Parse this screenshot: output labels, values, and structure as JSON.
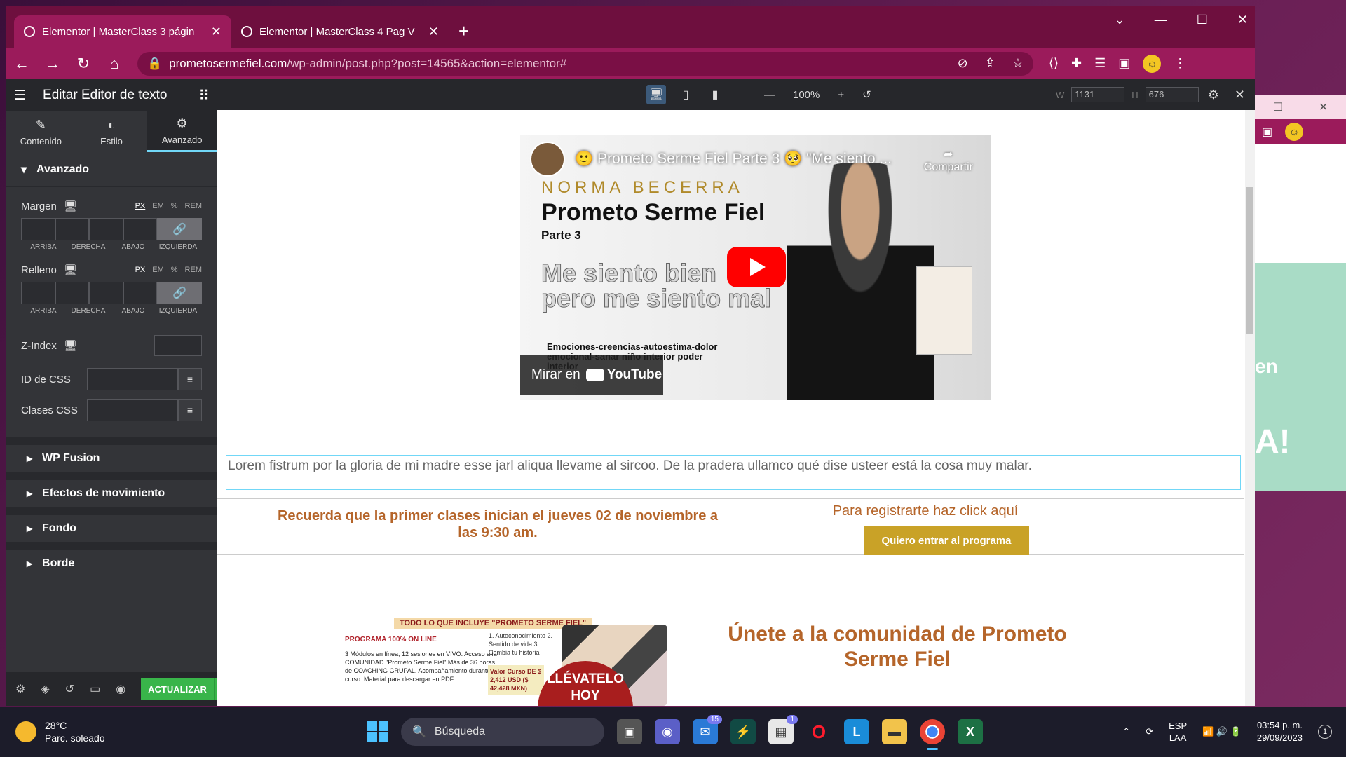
{
  "browser": {
    "tabs": [
      {
        "title": "Elementor | MasterClass 3 págin",
        "close": "✕"
      },
      {
        "title": "Elementor | MasterClass 4 Pag V",
        "close": "✕"
      }
    ],
    "new_tab": "+",
    "window_controls": [
      "⌄",
      "—",
      "☐",
      "✕"
    ],
    "url_domain": "prometosermefiel.com",
    "url_path": "/wp-admin/post.php?post=14565&action=elementor#"
  },
  "panel": {
    "title": "Editar Editor de texto",
    "tabs": [
      {
        "label": "Contenido",
        "icon": "pencil-icon"
      },
      {
        "label": "Estilo",
        "icon": "half-circle-icon"
      },
      {
        "label": "Avanzado",
        "icon": "gear-icon"
      }
    ],
    "section_title": "Avanzado",
    "margen_label": "Margen",
    "relleno_label": "Relleno",
    "units": [
      "PX",
      "EM",
      "%",
      "REM"
    ],
    "dim_labels": [
      "ARRIBA",
      "DERECHA",
      "ABAJO",
      "IZQUIERDA"
    ],
    "zindex_label": "Z-Index",
    "css_id_label": "ID de CSS",
    "css_classes_label": "Clases CSS",
    "collapsed_sections": [
      "WP Fusion",
      "Efectos de movimiento",
      "Fondo",
      "Borde"
    ],
    "update_label": "ACTUALIZAR"
  },
  "preview_bar": {
    "zoom": "100%",
    "w_label": "W",
    "w_value": "1131",
    "h_label": "H",
    "h_value": "676"
  },
  "video": {
    "title": "🙂 Prometo Serme Fiel Parte 3 🥺 \"Me siento ...",
    "share": "Compartir",
    "author": "NORMA BECERRA",
    "big_title": "Prometo Serme Fiel",
    "part": "Parte 3",
    "tagline": "Me siento bien pero me siento mal",
    "sub_tag": "Emociones-creencias-autoestima-dolor emocional-sanar niño interior poder interior",
    "watch_on": "Mirar en",
    "yt_brand": "YouTube"
  },
  "page": {
    "lorem": "Lorem fistrum por la gloria de mi madre esse jarl aliqua llevame al sircoo. De la pradera ullamco qué dise usteer está la cosa muy malar.",
    "cta_left": "Recuerda que la primer clases inician el jueves 02 de noviembre a las 9:30 am.",
    "cta_right_label": "Para registrarte haz click aquí",
    "cta_button": "Quiero entrar al programa",
    "promo_head": "TODO LO QUE INCLUYE \"PROMETO SERME FIEL\"",
    "promo_sub": "PROGRAMA 100% ON LINE",
    "promo_list": "3 Módulos en línea, 12 sesiones en VIVO. Acceso a la COMUNIDAD \"Prometo Serme Fiel\" Más de 36 horas de COACHING GRUPAL. Acompañamiento durante el curso. Material para descargar en PDF",
    "promo_list2": "1. Autoconocimiento 2. Sentido de vida 3. Cambia tu historia",
    "promo_price": "Valor Curso DE $ 2,412 USD ($ 42,428 MXN)",
    "promo_badge": "LLÉVATELO HOY",
    "community_title": "Únete a la comunidad de Prometo Serme Fiel"
  },
  "back_window": {
    "text1": "en",
    "text2": "A!"
  },
  "taskbar": {
    "temp": "28°C",
    "weather": "Parc. soleado",
    "search": "Búsqueda",
    "mail_badge": "15",
    "teams_badge": "1",
    "lang1": "ESP",
    "lang2": "LAA",
    "time": "03:54 p. m.",
    "date": "29/09/2023",
    "notif_count": "1"
  }
}
